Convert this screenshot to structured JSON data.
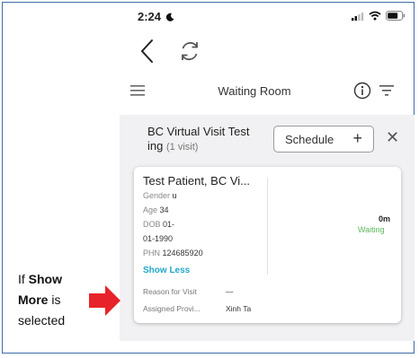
{
  "status_bar": {
    "time": "2:24",
    "moon_icon": "moon-icon",
    "signal_icon": "signal-icon",
    "wifi_icon": "wifi-icon",
    "battery_icon": "battery-icon"
  },
  "nav": {
    "back_icon": "chevron-left-icon",
    "refresh_icon": "refresh-icon"
  },
  "header": {
    "title": "Waiting Room",
    "menu_icon": "hamburger-icon",
    "info_icon": "info-icon",
    "filter_icon": "filter-icon"
  },
  "location": {
    "title_line1": "BC Virtual Visit Test",
    "title_line2": "ing",
    "visits": "(1 visit)",
    "schedule_label": "Schedule",
    "schedule_icon": "plus-icon",
    "close_icon": "close-icon"
  },
  "patient": {
    "name": "Test Patient, BC Vi...",
    "gender_label": "Gender",
    "gender_value": "u",
    "age_label": "Age",
    "age_value": "34",
    "dob_label": "DOB",
    "dob_value_1": "01-",
    "dob_value_2": "01-1990",
    "phn_label": "PHN",
    "phn_value": "124685920",
    "show_less": "Show Less",
    "duration": "0m",
    "status": "Waiting",
    "reason_label": "Reason for Visit",
    "reason_value": "—",
    "provider_label": "Assigned Provi...",
    "provider_value": "Xinh Ta"
  },
  "annotation": {
    "line1_prefix": "If",
    "line1_bold": "Show",
    "line2_bold": "More",
    "line2_suffix": "is",
    "line3": "selected"
  },
  "colors": {
    "accent": "#22a7c9",
    "waiting": "#5cb85c",
    "arrow": "#e8222a",
    "frame": "#3c6ea8"
  }
}
